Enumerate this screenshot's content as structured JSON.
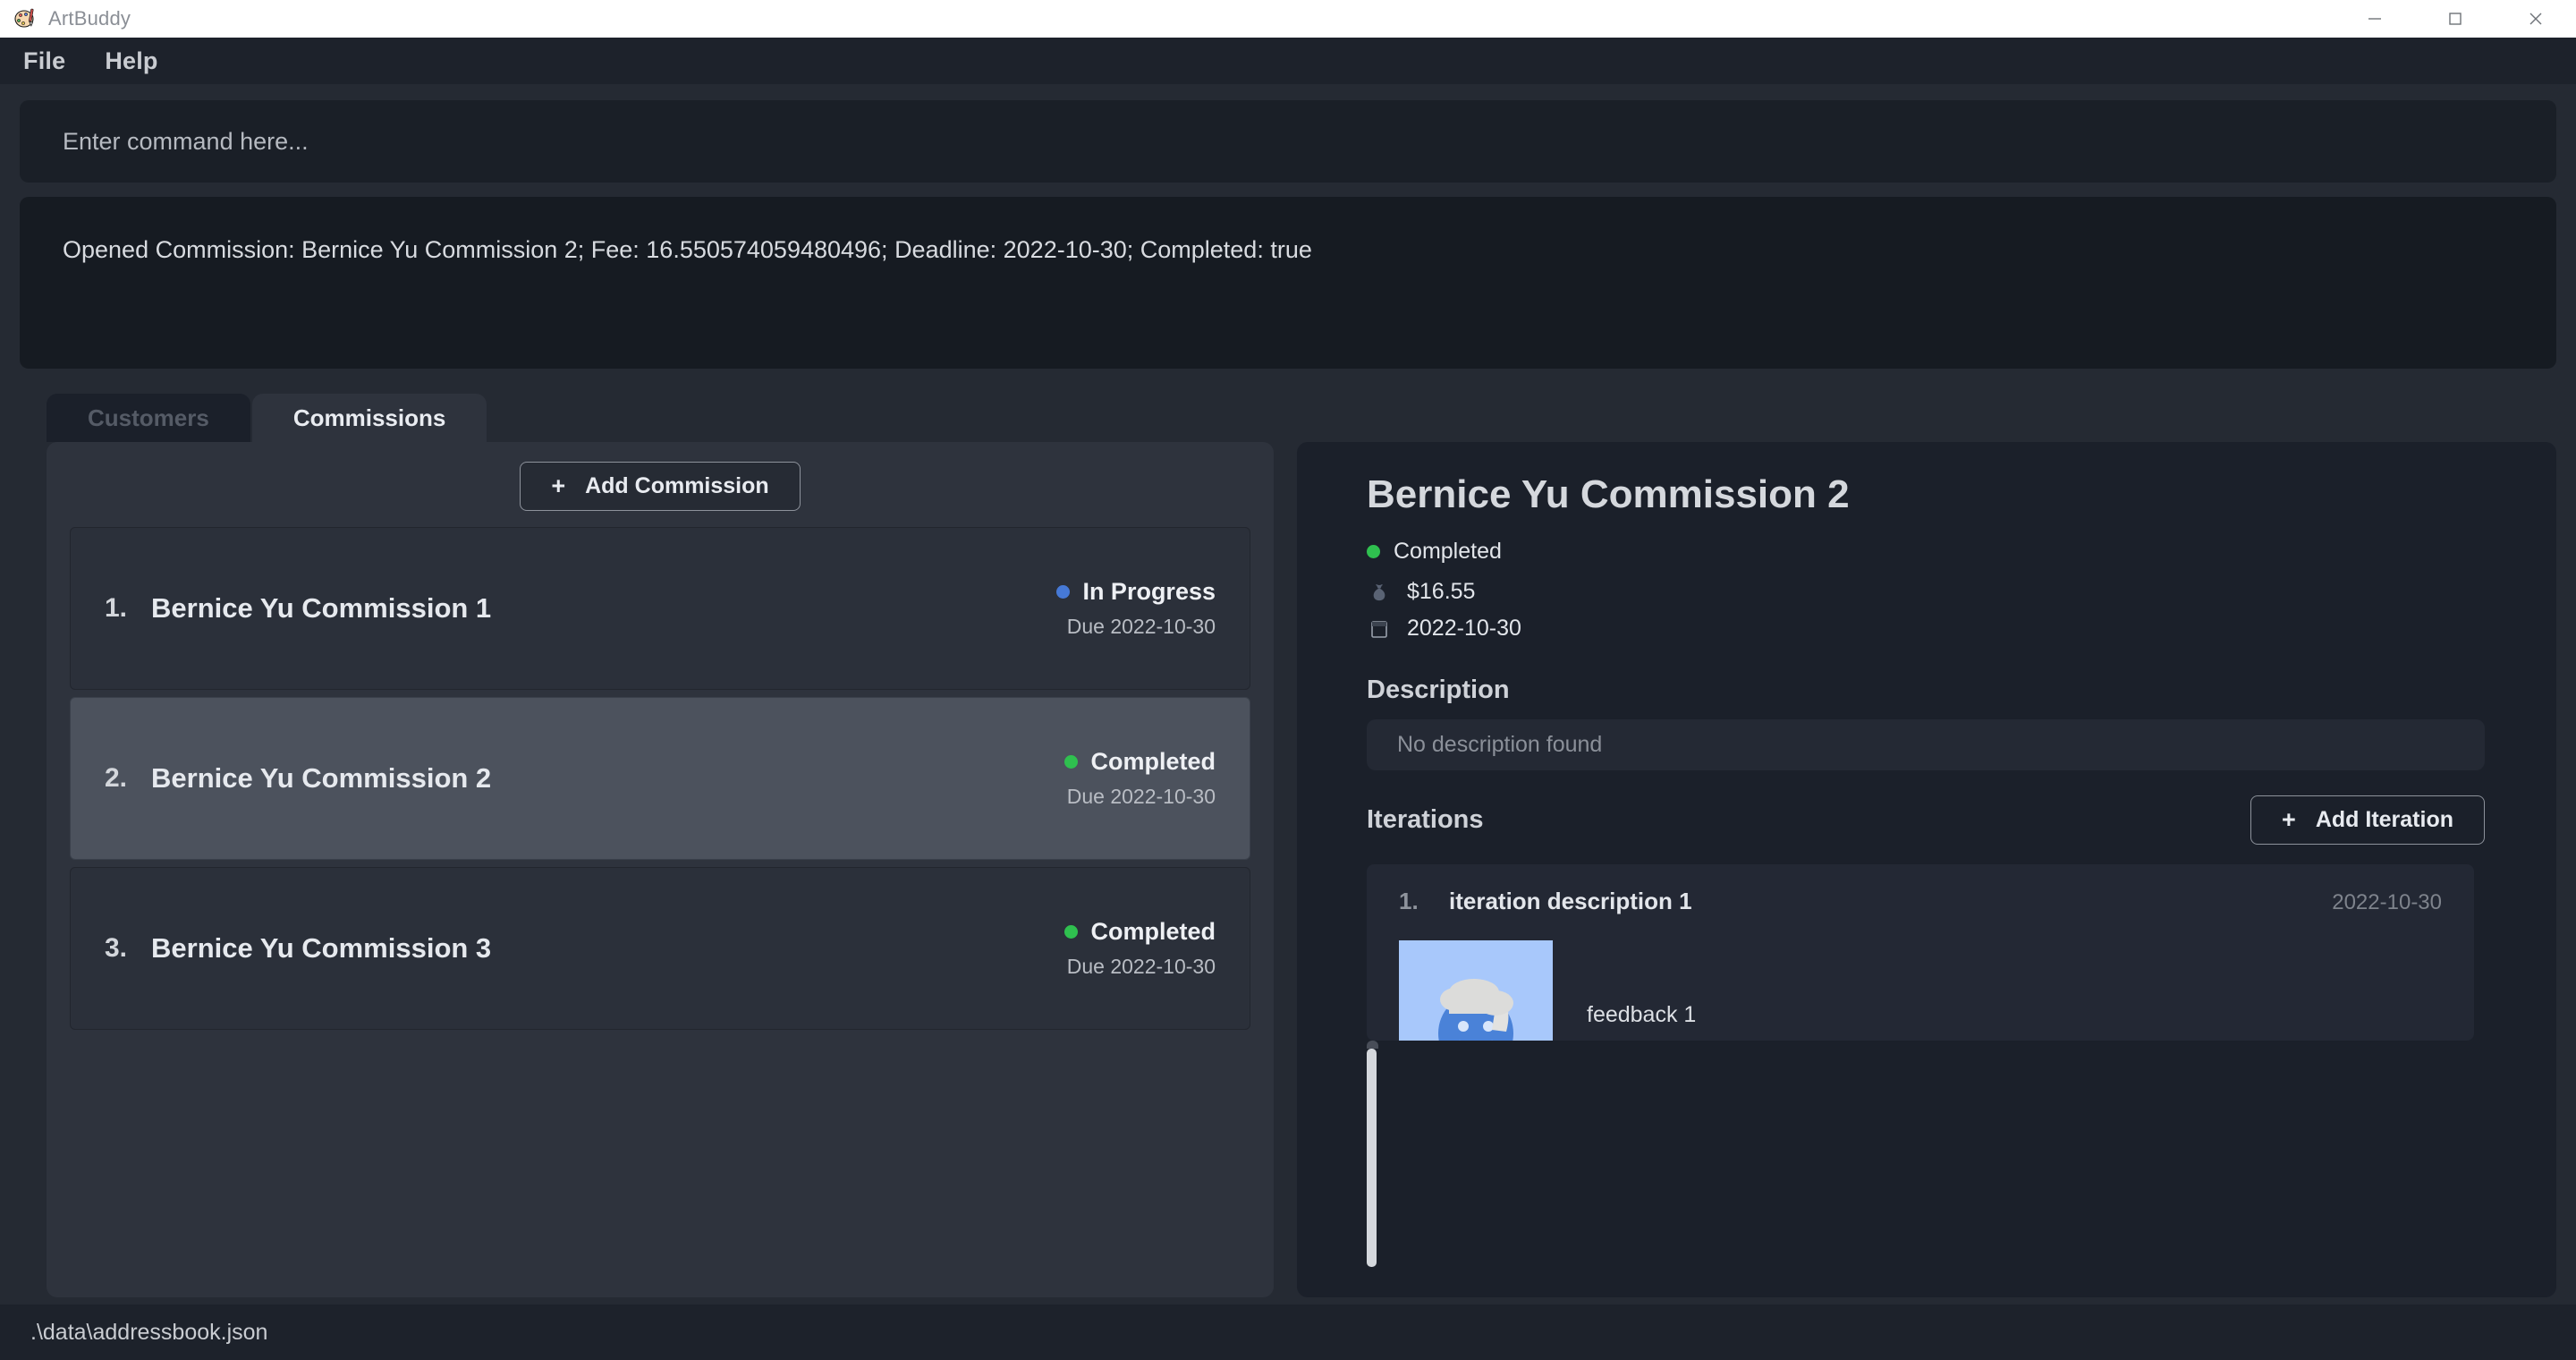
{
  "window": {
    "title": "ArtBuddy",
    "app_icon": "palette-icon",
    "controls": {
      "minimize": "minimize-icon",
      "maximize": "maximize-icon",
      "close": "close-icon"
    }
  },
  "menubar": {
    "items": [
      "File",
      "Help"
    ]
  },
  "command": {
    "placeholder": "Enter command here...",
    "result": "Opened Commission: Bernice Yu Commission 2; Fee: 16.550574059480496; Deadline: 2022-10-30; Completed: true"
  },
  "tabs": [
    {
      "label": "Customers",
      "active": false
    },
    {
      "label": "Commissions",
      "active": true
    }
  ],
  "left_panel": {
    "add_button": {
      "plus": "+",
      "label": "Add Commission"
    },
    "commissions": [
      {
        "index": "1.",
        "name": "Bernice Yu Commission 1",
        "status": "In Progress",
        "status_color": "#4679d6",
        "due": "Due 2022-10-30",
        "selected": false
      },
      {
        "index": "2.",
        "name": "Bernice Yu Commission 2",
        "status": "Completed",
        "status_color": "#2fc04f",
        "due": "Due 2022-10-30",
        "selected": true
      },
      {
        "index": "3.",
        "name": "Bernice Yu Commission 3",
        "status": "Completed",
        "status_color": "#2fc04f",
        "due": "Due 2022-10-30",
        "selected": false
      }
    ]
  },
  "detail": {
    "title": "Bernice Yu Commission 2",
    "status": "Completed",
    "status_color": "#2fc04f",
    "fee": "$16.55",
    "fee_icon": "money-bag-icon",
    "deadline": "2022-10-30",
    "deadline_icon": "calendar-icon",
    "description_heading": "Description",
    "description_placeholder": "No description found",
    "iterations_heading": "Iterations",
    "add_iteration_button": {
      "plus": "+",
      "label": "Add Iteration"
    },
    "iterations": [
      {
        "index": "1.",
        "description": "iteration description 1",
        "date": "2022-10-30",
        "feedback": "feedback 1",
        "image": "blue-chef-face-thumbnail"
      }
    ]
  },
  "statusbar": {
    "path": ".\\data\\addressbook.json"
  }
}
